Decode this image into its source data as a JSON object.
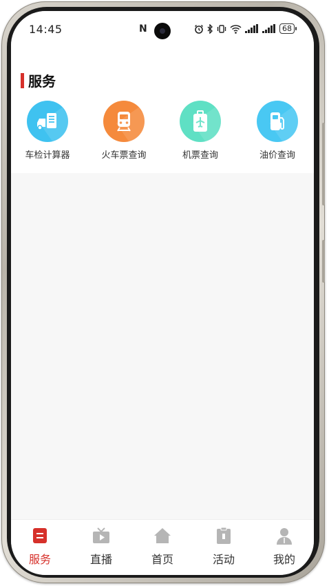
{
  "status_bar": {
    "time": "14:45",
    "battery": "68",
    "icons": [
      "nfc-icon",
      "alarm-icon",
      "bluetooth-icon",
      "vibrate-icon",
      "wifi-icon",
      "signal-icon",
      "signal-icon",
      "battery-icon"
    ]
  },
  "section": {
    "title": "服务",
    "accent_color": "#d6302a"
  },
  "services": [
    {
      "label": "车检计算器",
      "icon": "car-inspection-icon",
      "color": "#3fc2f0"
    },
    {
      "label": "火车票查询",
      "icon": "train-icon",
      "color": "#f58a3c"
    },
    {
      "label": "机票查询",
      "icon": "airplane-luggage-icon",
      "color": "#5fe0c4"
    },
    {
      "label": "油价查询",
      "icon": "fuel-pump-icon",
      "color": "#49c8f3"
    }
  ],
  "tabbar": {
    "active_color": "#d6302a",
    "inactive_color": "#b5b5b5",
    "tabs": [
      {
        "label": "服务",
        "icon": "service-icon",
        "active": true
      },
      {
        "label": "直播",
        "icon": "tv-icon",
        "active": false
      },
      {
        "label": "首页",
        "icon": "home-icon",
        "active": false
      },
      {
        "label": "活动",
        "icon": "clipboard-icon",
        "active": false
      },
      {
        "label": "我的",
        "icon": "user-icon",
        "active": false
      }
    ]
  }
}
